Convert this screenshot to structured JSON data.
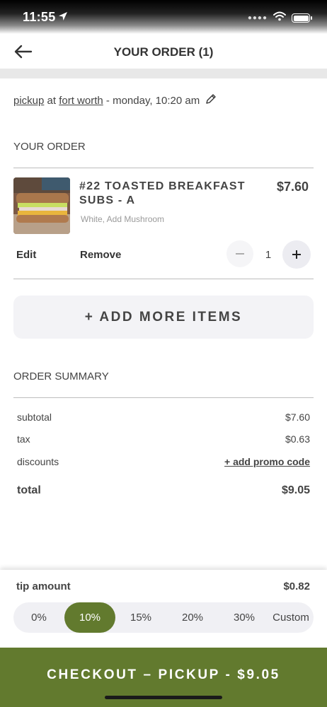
{
  "status_bar": {
    "time": "11:55"
  },
  "header": {
    "title": "YOUR ORDER (1)"
  },
  "pickup": {
    "mode": "pickup",
    "at": "at",
    "location": "fort worth",
    "time": "- monday, 10:20 am"
  },
  "order": {
    "section_label": "YOUR ORDER",
    "items": [
      {
        "name": "#22 TOASTED BREAKFAST SUBS - A",
        "price": "$7.60",
        "modifiers": "White, Add Mushroom",
        "edit_label": "Edit",
        "remove_label": "Remove",
        "quantity": "1"
      }
    ],
    "add_more_label": "+ ADD MORE ITEMS"
  },
  "summary": {
    "section_label": "ORDER SUMMARY",
    "subtotal_label": "subtotal",
    "subtotal_value": "$7.60",
    "tax_label": "tax",
    "tax_value": "$0.63",
    "discounts_label": "discounts",
    "promo_label": "+ add promo code",
    "total_label": "total",
    "total_value": "$9.05"
  },
  "tip": {
    "label": "tip amount",
    "value": "$0.82",
    "options": [
      "0%",
      "10%",
      "15%",
      "20%",
      "30%",
      "Custom"
    ],
    "selected": "10%"
  },
  "checkout": {
    "label": "CHECKOUT – PICKUP - $9.05"
  },
  "colors": {
    "accent": "#627a2e"
  },
  "icons": [
    "location-arrow-icon",
    "signal-dots-icon",
    "wifi-icon",
    "battery-icon",
    "back-arrow-icon",
    "pencil-icon",
    "minus-icon",
    "plus-icon"
  ]
}
